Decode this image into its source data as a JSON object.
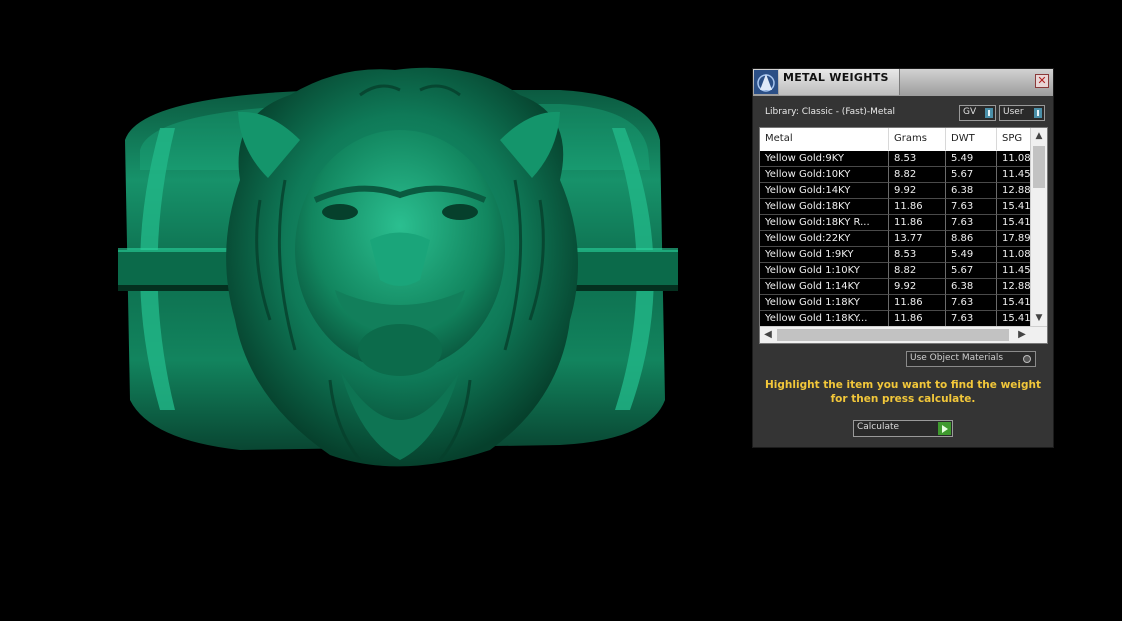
{
  "viewport": {
    "model": "lion-head-ring",
    "model_color": "#0f7a56"
  },
  "panel": {
    "title": "METAL WEIGHTS",
    "close_glyph": "✕",
    "library_label": "Library: Classic - (Fast)-Metal",
    "toggles": {
      "gv": "GV",
      "user": "User"
    },
    "columns": [
      "Metal",
      "Grams",
      "DWT",
      "SPG"
    ],
    "rows": [
      {
        "metal": "Yellow Gold:9KY",
        "grams": "8.53",
        "dwt": "5.49",
        "spg": "11.08"
      },
      {
        "metal": "Yellow Gold:10KY",
        "grams": "8.82",
        "dwt": "5.67",
        "spg": "11.45"
      },
      {
        "metal": "Yellow Gold:14KY",
        "grams": "9.92",
        "dwt": "6.38",
        "spg": "12.88"
      },
      {
        "metal": "Yellow Gold:18KY",
        "grams": "11.86",
        "dwt": "7.63",
        "spg": "15.41"
      },
      {
        "metal": "Yellow Gold:18KY R...",
        "grams": "11.86",
        "dwt": "7.63",
        "spg": "15.41"
      },
      {
        "metal": "Yellow Gold:22KY",
        "grams": "13.77",
        "dwt": "8.86",
        "spg": "17.89"
      },
      {
        "metal": "Yellow Gold 1:9KY",
        "grams": "8.53",
        "dwt": "5.49",
        "spg": "11.08"
      },
      {
        "metal": "Yellow Gold 1:10KY",
        "grams": "8.82",
        "dwt": "5.67",
        "spg": "11.45"
      },
      {
        "metal": "Yellow Gold 1:14KY",
        "grams": "9.92",
        "dwt": "6.38",
        "spg": "12.88"
      },
      {
        "metal": "Yellow Gold 1:18KY",
        "grams": "11.86",
        "dwt": "7.63",
        "spg": "15.41"
      },
      {
        "metal": "Yellow Gold 1:18KY...",
        "grams": "11.86",
        "dwt": "7.63",
        "spg": "15.41"
      }
    ],
    "scroll": {
      "up": "▲",
      "down": "▼",
      "left": "◀",
      "right": "▶"
    },
    "use_object_materials": "Use Object Materials",
    "hint": "Highlight the item you want to find the weight for then press calculate.",
    "calculate_label": "Calculate"
  }
}
